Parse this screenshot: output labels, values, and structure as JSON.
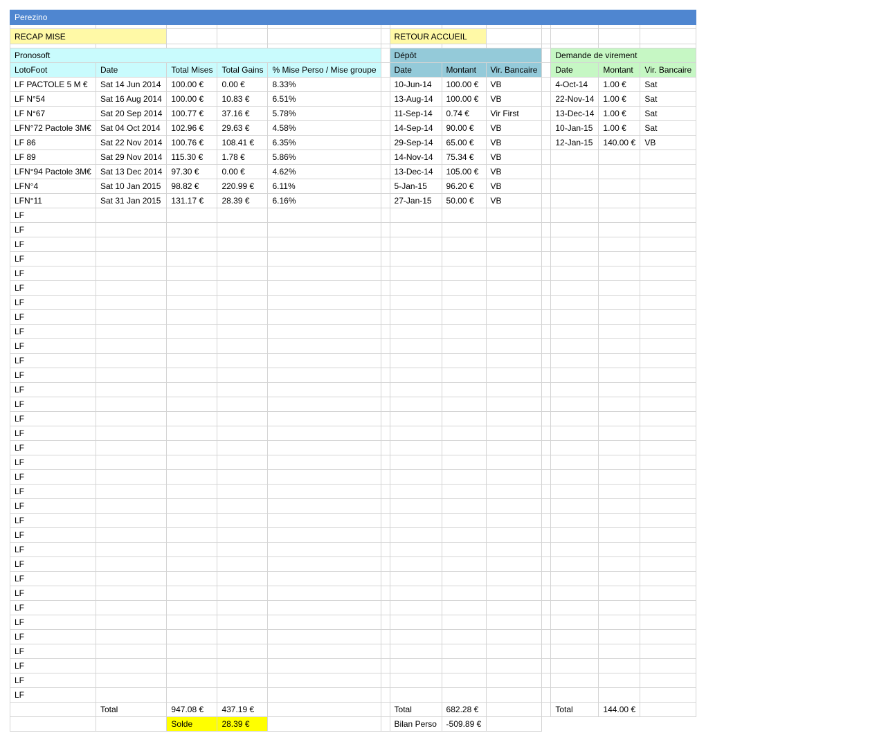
{
  "title": "Perezino",
  "links": {
    "recap": "RECAP MISE",
    "accueil": "RETOUR ACCUEIL"
  },
  "pronosoft": {
    "section": "Pronosoft",
    "headers": [
      "LotoFoot",
      "Date",
      "Total Mises",
      "Total Gains",
      "% Mise Perso / Mise groupe"
    ],
    "rows": [
      [
        "LF PACTOLE 5 M €",
        "Sat 14 Jun 2014",
        "100.00 €",
        "0.00 €",
        "8.33%"
      ],
      [
        "LF N°54",
        "Sat 16 Aug 2014",
        "100.00 €",
        "10.83 €",
        "6.51%"
      ],
      [
        "LF N°67",
        "Sat 20 Sep 2014",
        "100.77 €",
        "37.16 €",
        "5.78%"
      ],
      [
        "LFN°72 Pactole 3M€",
        "Sat 04 Oct 2014",
        "102.96 €",
        "29.63 €",
        "4.58%"
      ],
      [
        "LF 86",
        "Sat 22 Nov 2014",
        "100.76 €",
        "108.41 €",
        "6.35%"
      ],
      [
        "LF 89",
        "Sat 29 Nov 2014",
        "115.30 €",
        "1.78 €",
        "5.86%"
      ],
      [
        "LFN°94 Pactole 3M€",
        "Sat 13 Dec 2014",
        "97.30 €",
        "0.00 €",
        "4.62%"
      ],
      [
        "LFN°4",
        "Sat 10 Jan 2015",
        "98.82 €",
        "220.99 €",
        "6.11%"
      ],
      [
        "LFN°11",
        "Sat 31 Jan 2015",
        "131.17 €",
        "28.39 €",
        "6.16%"
      ]
    ],
    "placeholder": "LF",
    "placeholder_count": 34,
    "total_label": "Total",
    "total_mises": "947.08 €",
    "total_gains": "437.19 €",
    "solde_label": "Solde",
    "solde_value": "28.39 €"
  },
  "depot": {
    "section": "Dépôt",
    "headers": [
      "Date",
      "Montant",
      "Vir. Bancaire"
    ],
    "rows": [
      [
        "10-Jun-14",
        "100.00 €",
        "VB"
      ],
      [
        "13-Aug-14",
        "100.00 €",
        "VB"
      ],
      [
        "11-Sep-14",
        "0.74 €",
        "Vir First"
      ],
      [
        "14-Sep-14",
        "90.00 €",
        "VB"
      ],
      [
        "29-Sep-14",
        "65.00 €",
        "VB"
      ],
      [
        "14-Nov-14",
        "75.34 €",
        "VB"
      ],
      [
        "13-Dec-14",
        "105.00 €",
        "VB"
      ],
      [
        "5-Jan-15",
        "96.20 €",
        "VB"
      ],
      [
        "27-Jan-15",
        "50.00 €",
        "VB"
      ]
    ],
    "total_label": "Total",
    "total_value": "682.28 €",
    "bilan_label": "Bilan Perso",
    "bilan_value": "-509.89 €"
  },
  "virement": {
    "section": "Demande de virement",
    "headers": [
      "Date",
      "Montant",
      "Vir. Bancaire"
    ],
    "rows": [
      [
        "4-Oct-14",
        "1.00 €",
        "Sat"
      ],
      [
        "22-Nov-14",
        "1.00 €",
        "Sat"
      ],
      [
        "13-Dec-14",
        "1.00 €",
        "Sat"
      ],
      [
        "10-Jan-15",
        "1.00 €",
        "Sat"
      ],
      [
        "12-Jan-15",
        "140.00 €",
        "VB"
      ]
    ],
    "total_label": "Total",
    "total_value": "144.00 €"
  }
}
